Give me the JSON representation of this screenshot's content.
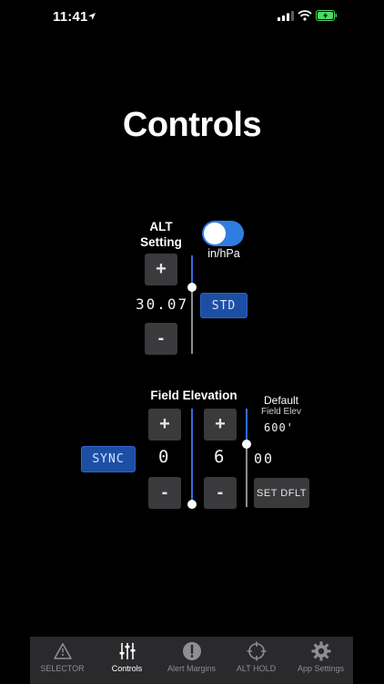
{
  "status_bar": {
    "time": "11:41"
  },
  "page": {
    "title": "Controls"
  },
  "alt_setting": {
    "label_line1": "ALT",
    "label_line2": "Setting",
    "unit_toggle_label": "in/hPa",
    "unit_toggle_on": true,
    "increment_label": "+",
    "decrement_label": "-",
    "value": "30.07",
    "std_button_label": "STD"
  },
  "field_elevation": {
    "label": "Field Elevation",
    "sync_button_label": "SYNC",
    "thousands_digit": "0",
    "hundreds_digit": "6",
    "suffix": "00",
    "increment_label": "+",
    "decrement_label": "-",
    "default_label_line1": "Default",
    "default_label_line2": "Field Elev",
    "default_value": "600'",
    "set_default_label": "SET DFLT"
  },
  "tab_bar": {
    "tabs": [
      {
        "label": "SELECTOR",
        "icon": "warning-triangle-icon",
        "active": false
      },
      {
        "label": "Controls",
        "icon": "sliders-icon",
        "active": true
      },
      {
        "label": "Alert Margins",
        "icon": "exclamation-circle-icon",
        "active": false
      },
      {
        "label": "ALT HOLD",
        "icon": "crosshair-icon",
        "active": false
      },
      {
        "label": "App Settings",
        "icon": "gear-icon",
        "active": false
      }
    ]
  },
  "colors": {
    "background": "#000000",
    "accent_blue": "#2f7de1",
    "button_blue": "#1c4fa3",
    "button_gray": "#3a3a3c",
    "tabbar_bg": "#2a2a2c",
    "battery_green": "#4cd964"
  }
}
